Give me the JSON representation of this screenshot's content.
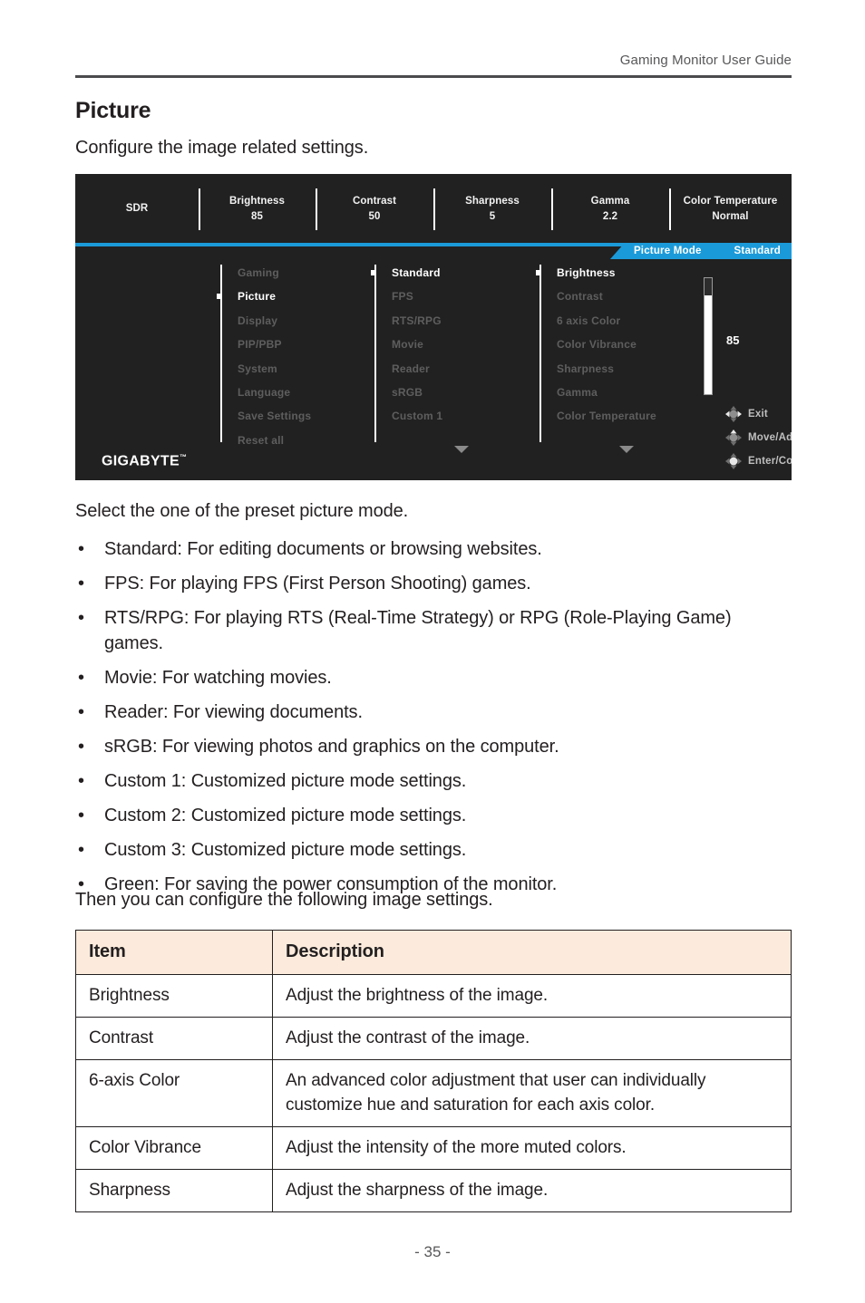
{
  "header": {
    "running_head": "Gaming Monitor User Guide"
  },
  "page": {
    "title": "Picture",
    "intro": "Configure the image related settings.",
    "lead": "Select the one of the preset picture mode.",
    "then_line": "Then you can configure the following image settings.",
    "page_number": "- 35 -",
    "bullet_char": "•"
  },
  "bullets": [
    "Standard: For editing documents or browsing websites.",
    "FPS: For playing FPS (First Person Shooting) games.",
    "RTS/RPG: For playing RTS (Real-Time Strategy) or RPG (Role-Playing Game) games.",
    "Movie: For watching movies.",
    "Reader: For viewing documents.",
    "sRGB: For viewing photos and graphics on the computer.",
    "Custom 1: Customized picture mode settings.",
    "Custom 2: Customized picture mode settings.",
    "Custom 3: Customized picture mode settings.",
    "Green: For saving the power consumption of the monitor."
  ],
  "table": {
    "headers": {
      "item": "Item",
      "description": "Description"
    },
    "header_bg": "#fcebdc",
    "rows": [
      {
        "item": "Brightness",
        "description": "Adjust the brightness of the image."
      },
      {
        "item": "Contrast",
        "description": "Adjust the contrast of the image."
      },
      {
        "item": "6-axis Color",
        "description": "An advanced color adjustment that user can individually customize hue and saturation for each axis color."
      },
      {
        "item": "Color Vibrance",
        "description": "Adjust the intensity of the more muted colors."
      },
      {
        "item": "Sharpness",
        "description": "Adjust the sharpness of the image."
      }
    ]
  },
  "osd": {
    "accent_blue": "#1b9ad9",
    "background": "#212121",
    "statusbar": [
      {
        "label": "SDR",
        "value": ""
      },
      {
        "label": "Brightness",
        "value": "85"
      },
      {
        "label": "Contrast",
        "value": "50"
      },
      {
        "label": "Sharpness",
        "value": "5"
      },
      {
        "label": "Gamma",
        "value": "2.2"
      },
      {
        "label": "Color Temperature",
        "value": "Normal"
      }
    ],
    "menu_col1": [
      {
        "label": "Gaming",
        "active": false
      },
      {
        "label": "Picture",
        "active": true
      },
      {
        "label": "Display",
        "active": false
      },
      {
        "label": "PIP/PBP",
        "active": false
      },
      {
        "label": "System",
        "active": false
      },
      {
        "label": "Language",
        "active": false
      },
      {
        "label": "Save Settings",
        "active": false
      },
      {
        "label": "Reset all",
        "active": false
      }
    ],
    "menu_col2": [
      {
        "label": "Standard",
        "active": true
      },
      {
        "label": "FPS",
        "active": false
      },
      {
        "label": "RTS/RPG",
        "active": false
      },
      {
        "label": "Movie",
        "active": false
      },
      {
        "label": "Reader",
        "active": false
      },
      {
        "label": "sRGB",
        "active": false
      },
      {
        "label": "Custom 1",
        "active": false
      }
    ],
    "menu_col3": [
      {
        "label": "Brightness",
        "active": true
      },
      {
        "label": "Contrast",
        "active": false
      },
      {
        "label": "6 axis Color",
        "active": false
      },
      {
        "label": "Color Vibrance",
        "active": false
      },
      {
        "label": "Sharpness",
        "active": false
      },
      {
        "label": "Gamma",
        "active": false
      },
      {
        "label": "Color Temperature",
        "active": false
      }
    ],
    "banner": {
      "label": "Picture Mode",
      "value": "Standard"
    },
    "slider": {
      "value": "85",
      "percent": 85
    },
    "hints": [
      {
        "label": "Exit",
        "icon": "joystick-left-icon"
      },
      {
        "label": "Move/Adjust",
        "icon": "joystick-up-icon"
      },
      {
        "label": "Enter/Confirm",
        "icon": "joystick-center-icon"
      }
    ],
    "logo": "GIGABYTE"
  }
}
